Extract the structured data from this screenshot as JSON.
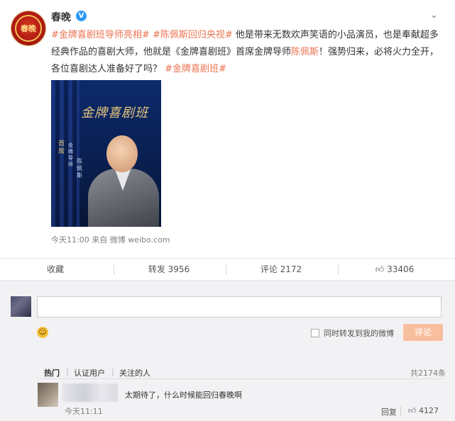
{
  "post": {
    "username": "春晚",
    "verified_badge": "V",
    "avatar_text": "春晚",
    "text": {
      "tag1": "#金牌喜剧班导师亮相#",
      "tag2": "#陈佩斯回归央视#",
      "body1": " 他是带来无数欢声笑语的小品演员，也是奉献超多经典作品的喜剧大师，他就是《金牌喜剧班》首席金牌导师",
      "name_link": "陈佩斯",
      "body2": "！强势归来，必将火力全开，各位喜剧达人准备好了吗？",
      "tag3": "#金牌喜剧班#"
    },
    "poster": {
      "title": "金牌喜剧班",
      "side_text_1": "首席",
      "side_text_2": "金牌导师",
      "side_text_3": "陈佩斯"
    },
    "meta": "今天11:00  来自 微博 weibo.com",
    "more_icon": "chevron-down-icon"
  },
  "actions": {
    "favorite": "收藏",
    "repost": "转发 3956",
    "comment": "评论 2172",
    "like": "33406"
  },
  "compose": {
    "input_value": "",
    "forward_label": "同时转发到我的微博",
    "submit_label": "评论"
  },
  "comments": {
    "filters": [
      "热门",
      "认证用户",
      "关注的人"
    ],
    "total": "共2174条",
    "items": [
      {
        "text": "太期待了，什么时候能回归春晚啊",
        "time": "今天11:11",
        "reply_label": "回复",
        "likes": "4127"
      }
    ]
  },
  "colors": {
    "link": "#eb7350",
    "submit_bg": "#f8bf9f",
    "comment_bg": "#f2f2f5",
    "verified": "#2b9af3"
  }
}
